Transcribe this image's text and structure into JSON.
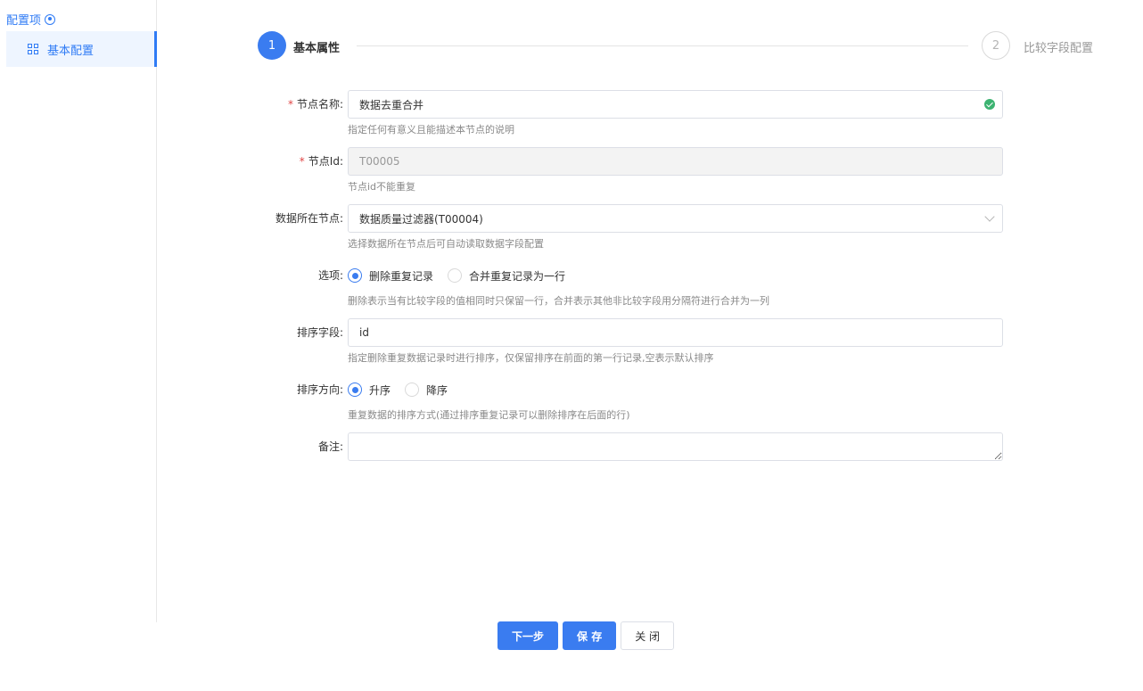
{
  "sidebar": {
    "title": "配置项",
    "title_icon": "target-icon",
    "items": [
      {
        "label": "基本配置",
        "icon": "grid-icon",
        "active": true
      }
    ]
  },
  "steps": [
    {
      "number": "1",
      "label": "基本属性",
      "active": true
    },
    {
      "number": "2",
      "label": "比较字段配置",
      "active": false
    }
  ],
  "form": {
    "node_name": {
      "label": "节点名称:",
      "required": true,
      "value": "数据去重合并",
      "hint": "指定任何有意义且能描述本节点的说明",
      "status_icon": "check-circle-icon"
    },
    "node_id": {
      "label": "节点Id:",
      "required": true,
      "value": "T00005",
      "hint": "节点id不能重复",
      "disabled": true
    },
    "source_node": {
      "label": "数据所在节点:",
      "value": "数据质量过滤器(T00004)",
      "hint": "选择数据所在节点后可自动读取数据字段配置"
    },
    "options": {
      "label": "选项:",
      "choices": [
        "删除重复记录",
        "合并重复记录为一行"
      ],
      "selected": "删除重复记录",
      "hint": "删除表示当有比较字段的值相同时只保留一行，合并表示其他非比较字段用分隔符进行合并为一列"
    },
    "sort_field": {
      "label": "排序字段:",
      "value": "id",
      "hint": "指定删除重复数据记录时进行排序，仅保留排序在前面的第一行记录,空表示默认排序"
    },
    "sort_direction": {
      "label": "排序方向:",
      "choices": [
        "升序",
        "降序"
      ],
      "selected": "升序",
      "hint": "重复数据的排序方式(通过排序重复记录可以删除排序在后面的行)"
    },
    "remark": {
      "label": "备注:",
      "value": ""
    }
  },
  "buttons": {
    "next": "下一步",
    "save": "保 存",
    "close": "关 闭"
  },
  "colors": {
    "primary": "#3a7cf0",
    "required": "#e04545",
    "success": "#3cb371"
  }
}
